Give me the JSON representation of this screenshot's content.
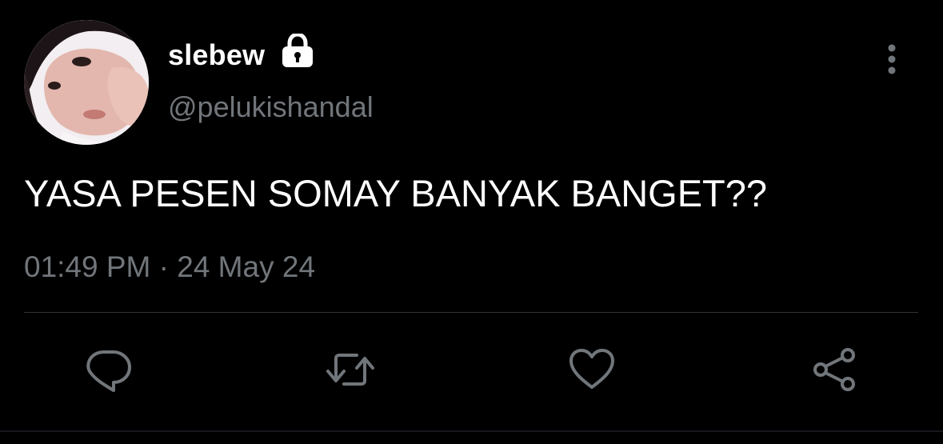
{
  "user": {
    "display_name": "slebew",
    "handle": "@pelukishandal",
    "protected_icon": "lock-icon",
    "avatar": "profile-photo"
  },
  "tweet": {
    "text": "YASA PESEN SOMAY BANYAK BANGET??",
    "timestamp": "01:49 PM · 24 May 24"
  },
  "menu": {
    "icon": "more-vertical-icon"
  },
  "actions": [
    {
      "name": "reply",
      "icon": "reply-icon"
    },
    {
      "name": "retweet",
      "icon": "retweet-icon"
    },
    {
      "name": "like",
      "icon": "heart-icon"
    },
    {
      "name": "share",
      "icon": "share-icon"
    }
  ],
  "colors": {
    "background": "#000000",
    "primary_text": "#ffffff",
    "secondary_text": "#71767b",
    "divider": "#2f3336"
  }
}
